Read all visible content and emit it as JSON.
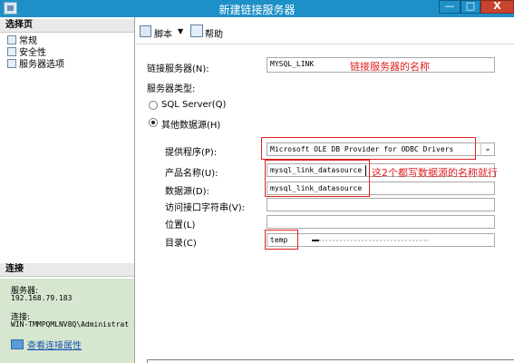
{
  "window": {
    "title": "新建链接服务器",
    "minimize": "—",
    "maximize": "□",
    "close": "X"
  },
  "left": {
    "select_page": "选择页",
    "pages": [
      "常规",
      "安全性",
      "服务器选项"
    ],
    "connection_header": "连接",
    "server_label": "服务器:",
    "server_value": "192.168.79.183",
    "connection_label": "连接:",
    "connection_value": "WIN-TMMPQMLNV8Q\\Administrat",
    "view_link": "查看连接属性"
  },
  "toolbar": {
    "script": "脚本",
    "help": "帮助",
    "arrow": "▼"
  },
  "form": {
    "linked_server_label": "链接服务器(N):",
    "linked_server_value": "MYSQL_LINK",
    "server_type_label": "服务器类型:",
    "sql_server_label": "SQL Server(Q)",
    "other_source_label": "其他数据源(H)",
    "provider_label": "提供程序(P):",
    "provider_value": "Microsoft OLE DB Provider for ODBC Drivers",
    "product_label": "产品名称(U):",
    "product_value": "mysql_link_datasource",
    "datasource_label": "数据源(D):",
    "datasource_value": "mysql_link_datasource",
    "provider_string_label": "访问接口字符串(V):",
    "location_label": "位置(L)",
    "catalog_label": "目录(C)",
    "catalog_value": "temp"
  },
  "annotations": {
    "name_note": "链接服务器的名称",
    "datasource_note": "这2个都写数据源的名称就行"
  },
  "colors": {
    "titlebar": "#1e90c8",
    "annotation": "#e02020",
    "connection_panel": "#d6e6cf"
  }
}
